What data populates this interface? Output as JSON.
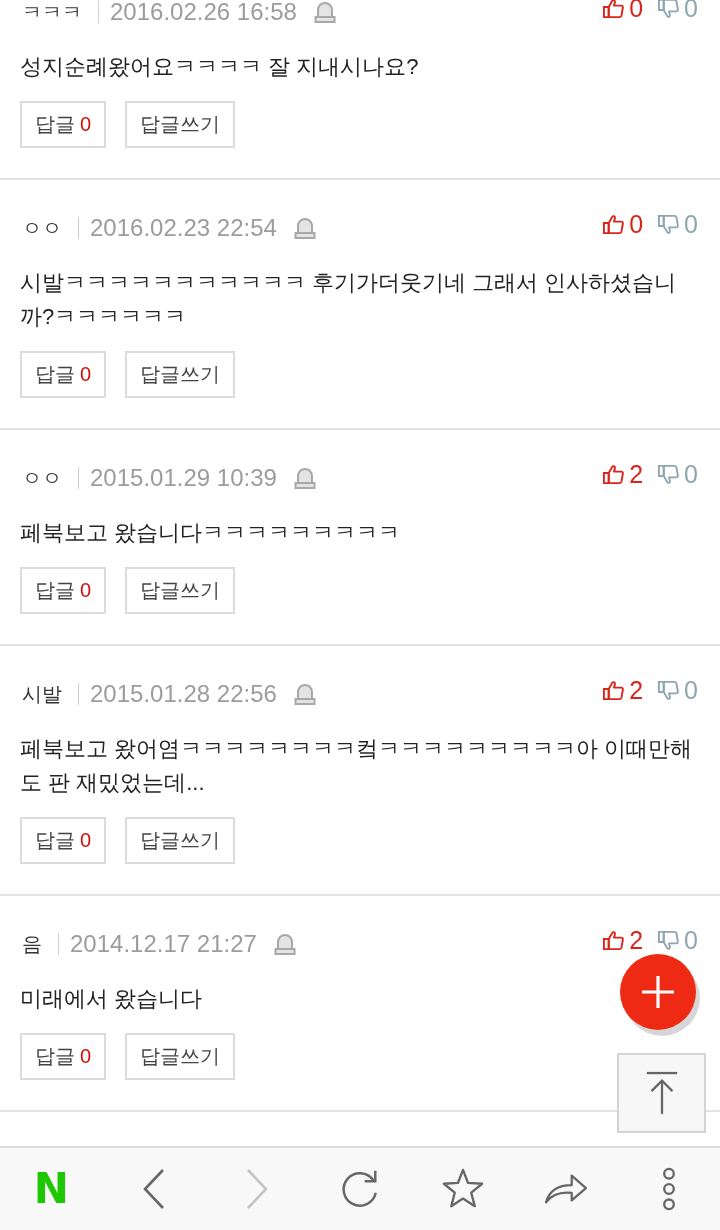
{
  "comments": [
    {
      "author": "ㅋㅋㅋ",
      "date": "2016.02.26 16:58",
      "likes": "0",
      "dislikes": "0",
      "text": "성지순례왔어요ㅋㅋㅋㅋ 잘 지내시나요?",
      "reply_button": {
        "label": "답글",
        "count": "0"
      },
      "write_button": {
        "label": "답글쓰기"
      }
    },
    {
      "author": "ㅇㅇ",
      "date": "2016.02.23 22:54",
      "likes": "0",
      "dislikes": "0",
      "text": "시발ㅋㅋㅋㅋㅋㅋㅋㅋㅋㅋㅋ 후기가더웃기네 그래서 인사하셨습니까?ㅋㅋㅋㅋㅋㅋ",
      "reply_button": {
        "label": "답글",
        "count": "0"
      },
      "write_button": {
        "label": "답글쓰기"
      }
    },
    {
      "author": "ㅇㅇ",
      "date": "2015.01.29 10:39",
      "likes": "2",
      "dislikes": "0",
      "text": "페북보고 왔습니다ㅋㅋㅋㅋㅋㅋㅋㅋㅋ",
      "reply_button": {
        "label": "답글",
        "count": "0"
      },
      "write_button": {
        "label": "답글쓰기"
      }
    },
    {
      "author": "시발",
      "date": "2015.01.28 22:56",
      "likes": "2",
      "dislikes": "0",
      "text": "페북보고 왔어염ㅋㅋㅋㅋㅋㅋㅋㅋ컼ㅋㅋㅋㅋㅋㅋㅋㅋㅋ아 이때만해도 판 재밌었는데...",
      "reply_button": {
        "label": "답글",
        "count": "0"
      },
      "write_button": {
        "label": "답글쓰기"
      }
    },
    {
      "author": "음",
      "date": "2014.12.17 21:27",
      "likes": "2",
      "dislikes": "0",
      "text": "미래에서 왔습니다",
      "reply_button": {
        "label": "답글",
        "count": "0"
      },
      "write_button": {
        "label": "답글쓰기"
      }
    }
  ],
  "toolbar": {
    "logo": "N",
    "buttons": [
      {
        "kind": "back",
        "disabled": false
      },
      {
        "kind": "forward",
        "disabled": true
      },
      {
        "kind": "reload",
        "disabled": false
      },
      {
        "kind": "bookmark",
        "disabled": false
      },
      {
        "kind": "share",
        "disabled": false
      },
      {
        "kind": "more",
        "disabled": false
      }
    ]
  }
}
